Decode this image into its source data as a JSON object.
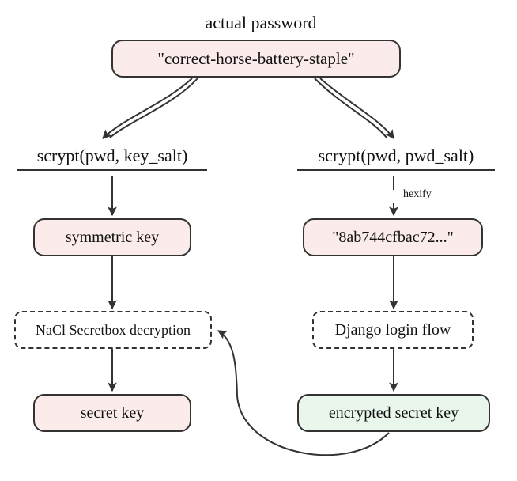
{
  "title": "actual password",
  "password_node": "\"correct-horse-battery-staple\"",
  "left": {
    "heading": "scrypt(pwd, key_salt)",
    "symkey": "symmetric key",
    "nacl": "NaCl Secretbox decryption",
    "secret": "secret key"
  },
  "right": {
    "heading": "scrypt(pwd, pwd_salt)",
    "hexify": "hexify",
    "hash": "\"8ab744cfbac72...\"",
    "django": "Django login flow",
    "encrypted": "encrypted secret key"
  }
}
